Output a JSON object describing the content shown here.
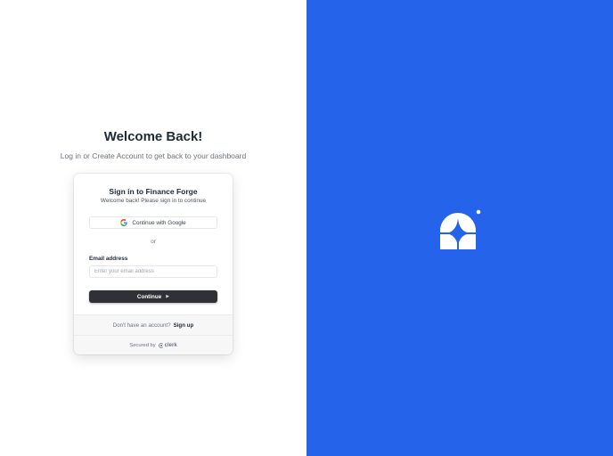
{
  "page": {
    "heading": "Welcome Back!",
    "subheading": "Log in or Create Account to get back to your dashboard"
  },
  "card": {
    "title": "Sign in to Finance Forge",
    "subtitle": "Welcome back! Please sign in to continue",
    "google_button": {
      "label": "Continue with Google",
      "icon": "google-icon"
    },
    "divider_text": "or",
    "email": {
      "label": "Email address",
      "placeholder": "Enter your email address",
      "value": ""
    },
    "continue_button": {
      "label": "Continue",
      "icon": "arrow-right-icon"
    },
    "footer": {
      "signup_prompt": "Don't have an account?",
      "signup_link": "Sign up",
      "secured_by": "Secured by",
      "brand": "clerk"
    }
  },
  "colors": {
    "accent_panel": "#2563eb",
    "button_dark": "#2f3137"
  },
  "right_panel": {
    "logo_icon": "app-logo-sparkle-icon"
  }
}
